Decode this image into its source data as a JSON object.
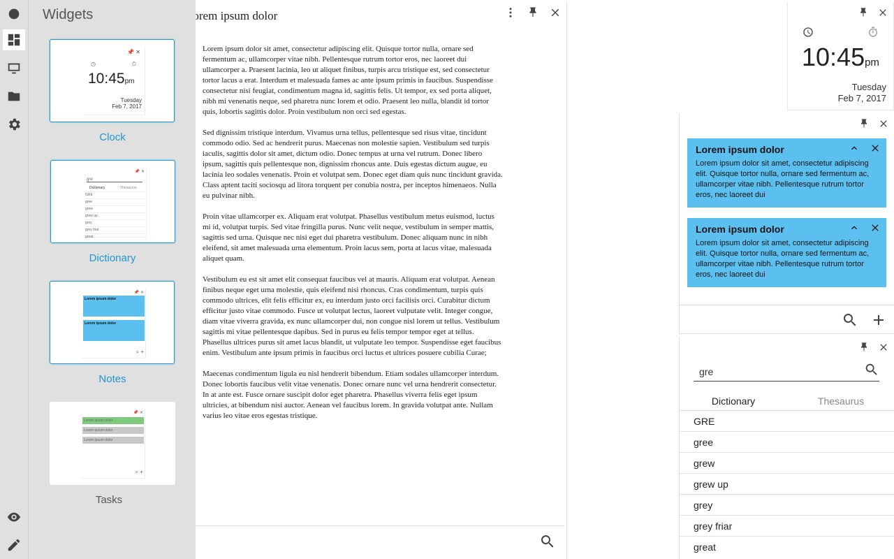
{
  "sidebar": {
    "title": "Widgets",
    "rail_icons": [
      "circle-icon",
      "dashboard-icon",
      "monitor-icon",
      "folder-icon",
      "gear-icon",
      "eye-icon",
      "pencil-icon"
    ],
    "widgets": [
      {
        "label": "Clock",
        "selected": true
      },
      {
        "label": "Dictionary",
        "selected": true
      },
      {
        "label": "Notes",
        "selected": true
      },
      {
        "label": "Tasks",
        "selected": false
      }
    ],
    "thumb_clock": {
      "time": "10:45",
      "ampm": "pm",
      "day": "Tuesday",
      "date": "Feb 7, 2017"
    },
    "thumb_dict": {
      "query": "gre",
      "tab1": "Dictionary",
      "tab2": "Thesaurus",
      "words": [
        "GRE",
        "gree",
        "grew",
        "grew up",
        "grey",
        "grey friar",
        "great"
      ]
    },
    "thumb_notes": {
      "title": "Lorem ipsum dolor"
    },
    "thumb_tasks": {
      "items": [
        "Lorem ipsum dolor",
        "Lorem ipsum dolor",
        "Lorem ipsum dolor"
      ]
    }
  },
  "document": {
    "title": "Lorem ipsum dolor",
    "paragraphs": [
      "Lorem ipsum dolor sit amet, consectetur adipiscing elit. Quisque tortor nulla, ornare sed fermentum ac, ullamcorper vitae nibh. Pellentesque rutrum tortor eros, nec laoreet dui ullamcorper a. Praesent lacinia, leo ut aliquet finibus, turpis arcu tristique est, sed consectetur tortor lacus a erat. Interdum et malesuada fames ac ante ipsum primis in faucibus. Suspendisse consectetur nisi feugiat, condimentum magna id, sagittis felis. Ut tempor, ex sed porta aliquet, nibh mi venenatis neque, sed pharetra nunc lorem et odio. Praesent leo nulla, blandit id tortor quis, lobortis sagittis dolor. Proin vestibulum non orci sed egestas.",
      "Sed dignissim tristique interdum. Vivamus urna tellus, pellentesque sed risus vitae, tincidunt commodo odio. Sed ac hendrerit purus. Maecenas non molestie sapien. Vestibulum sed turpis iaculis, sagittis dolor sit amet, dictum odio. Donec tempus at urna vel rutrum. Donec libero ipsum, sagittis quis pellentesque non, dignissim rhoncus ante. Duis egestas dictum augue, eu lacinia leo sodales venenatis. Proin et volutpat sem. Donec eget diam quis nunc tincidunt gravida. Class aptent taciti sociosqu ad litora torquent per conubia nostra, per inceptos himenaeos. Nulla eu pulvinar nibh.",
      "Proin vitae ullamcorper ex. Aliquam erat volutpat. Phasellus vestibulum metus euismod, luctus mi id, volutpat turpis. Sed vitae fringilla purus. Nunc velit neque, vestibulum in semper mattis, sagittis sed urna. Quisque nec nisi eget dui pharetra vestibulum. Donec aliquam nunc in nibh eleifend, sit amet malesuada urna elementum. Proin lacus sem, porta at lacus vitae, malesuada aliquet quam.",
      "Vestibulum eu est sit amet elit consequat faucibus vel at mauris. Aliquam erat volutpat. Aenean finibus neque eget urna molestie, quis eleifend nisi rhoncus. Cras condimentum, turpis quis commodo ultrices, elit felis efficitur ex, eu interdum justo orci facilisis orci. Curabitur dictum efficitur justo vitae commodo. Fusce ut volutpat lectus, laoreet vulputate velit. Integer congue, diam vitae viverra gravida, ex nunc ullamcorper dui, non congue nisl lorem ut tellus. Vestibulum sagittis mi vitae pellentesque dapibus. Sed in purus eu felis tempor tempor eget at tellus. Phasellus ultrices purus sit amet lacus blandit, ut vulputate leo tempor. Suspendisse eget faucibus enim. Vestibulum ante ipsum primis in faucibus orci luctus et ultrices posuere cubilia Curae;",
      "Maecenas condimentum ligula eu nisl hendrerit bibendum. Etiam sodales ullamcorper interdum. Donec lobortis faucibus velit vitae venenatis. Donec ornare nunc vel urna hendrerit consectetur. In at ante est. Fusce ornare suscipit dolor eget pharetra. Phasellus viverra felis eget ipsum ultricies, at bibendum nisi auctor. Aenean vel faucibus lorem. In gravida volutpat ante. Nullam varius leo vitae eros egestas tristique."
    ]
  },
  "clock": {
    "time": "10:45",
    "ampm": "pm",
    "day": "Tuesday",
    "date": "Feb 7, 2017"
  },
  "notes": [
    {
      "title": "Lorem ipsum dolor",
      "body": "Lorem ipsum dolor sit amet, consectetur adipiscing elit. Quisque tortor nulla, ornare sed fermentum ac, ullamcorper vitae nibh. Pellentesque rutrum tortor eros, nec laoreet dui"
    },
    {
      "title": "Lorem ipsum dolor",
      "body": "Lorem ipsum dolor sit amet, consectetur adipiscing elit. Quisque tortor nulla, ornare sed fermentum ac, ullamcorper vitae nibh. Pellentesque rutrum tortor eros, nec laoreet dui"
    }
  ],
  "dictionary": {
    "query": "gre",
    "tabs": [
      "Dictionary",
      "Thesaurus"
    ],
    "words": [
      "GRE",
      "gree",
      "grew",
      "grew up",
      "grey",
      "grey friar",
      "great"
    ]
  },
  "colors": {
    "accent": "#2196d3",
    "note_bg": "#5bc0f0",
    "panel_bg": "#e0e0e0",
    "task_done": "#7ecb7e",
    "task_pending": "#c8c8c8"
  }
}
